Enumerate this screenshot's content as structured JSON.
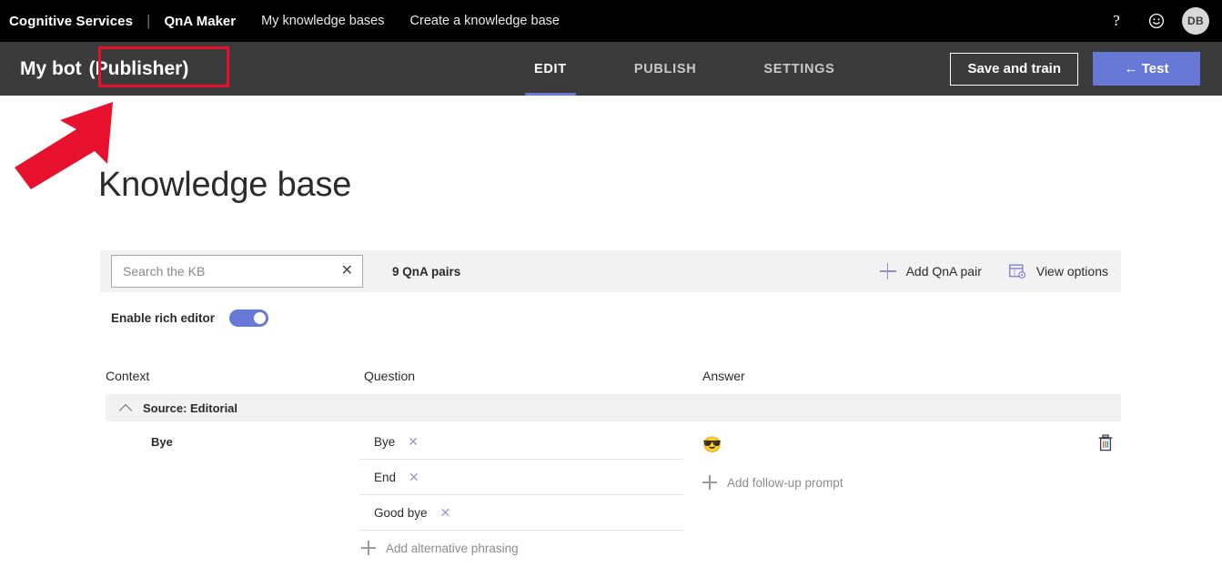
{
  "topbar": {
    "brand": "Cognitive Services",
    "separator": "|",
    "product": "QnA Maker",
    "links": [
      {
        "label": "My knowledge bases"
      },
      {
        "label": "Create a knowledge base"
      }
    ],
    "help_icon": "?",
    "feedback_icon": "smiley-face-icon",
    "avatar_initials": "DB"
  },
  "commandbar": {
    "kb_name": "My bot",
    "kb_publisher": "(Publisher)",
    "tabs": [
      {
        "label": "EDIT",
        "active": true
      },
      {
        "label": "PUBLISH",
        "active": false
      },
      {
        "label": "SETTINGS",
        "active": false
      }
    ],
    "save_button": "Save and train",
    "test_button": "← Test",
    "accent_color": "#6778d6",
    "bar_color": "#3b3b3b"
  },
  "annotation": {
    "highlight_color": "#e8112d",
    "arrow_color": "#e8112d",
    "target": "(Publisher)"
  },
  "page": {
    "heading": "Knowledge base"
  },
  "toolbar": {
    "search_placeholder": "Search the KB",
    "search_value": "",
    "clear_icon": "✕",
    "pair_count": "9 QnA pairs",
    "add_pair_label": "Add QnA pair",
    "add_pair_icon": "plus-icon",
    "view_options_label": "View options",
    "view_options_icon": "table-settings-icon",
    "background": "#f2f2f2"
  },
  "rich_editor": {
    "label": "Enable rich editor",
    "enabled": true
  },
  "table": {
    "columns": [
      {
        "label": "Context"
      },
      {
        "label": "Question"
      },
      {
        "label": "Answer"
      }
    ],
    "source_group": {
      "label": "Source: Editorial",
      "expanded": true,
      "collapse_icon": "chevron-up-icon"
    },
    "rows": [
      {
        "context": "Bye",
        "questions": [
          {
            "text": "Bye",
            "remove_icon": "✕"
          },
          {
            "text": "End",
            "remove_icon": "✕"
          },
          {
            "text": "Good bye",
            "remove_icon": "✕"
          }
        ],
        "add_phrasing_label": "Add alternative phrasing",
        "answer": "😎",
        "add_followup_label": "Add follow-up prompt",
        "delete_icon": "trash-icon"
      }
    ]
  }
}
